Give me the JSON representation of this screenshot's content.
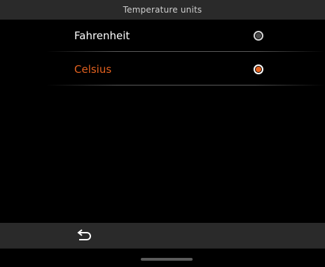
{
  "header": {
    "title": "Temperature units"
  },
  "options": [
    {
      "label": "Fahrenheit",
      "selected": false
    },
    {
      "label": "Celsius",
      "selected": true
    }
  ],
  "footer": {
    "back_icon": "back-arrow-icon"
  },
  "colors": {
    "accent": "#e3611f",
    "bar_background": "#2a2a2a",
    "background": "#000000"
  }
}
